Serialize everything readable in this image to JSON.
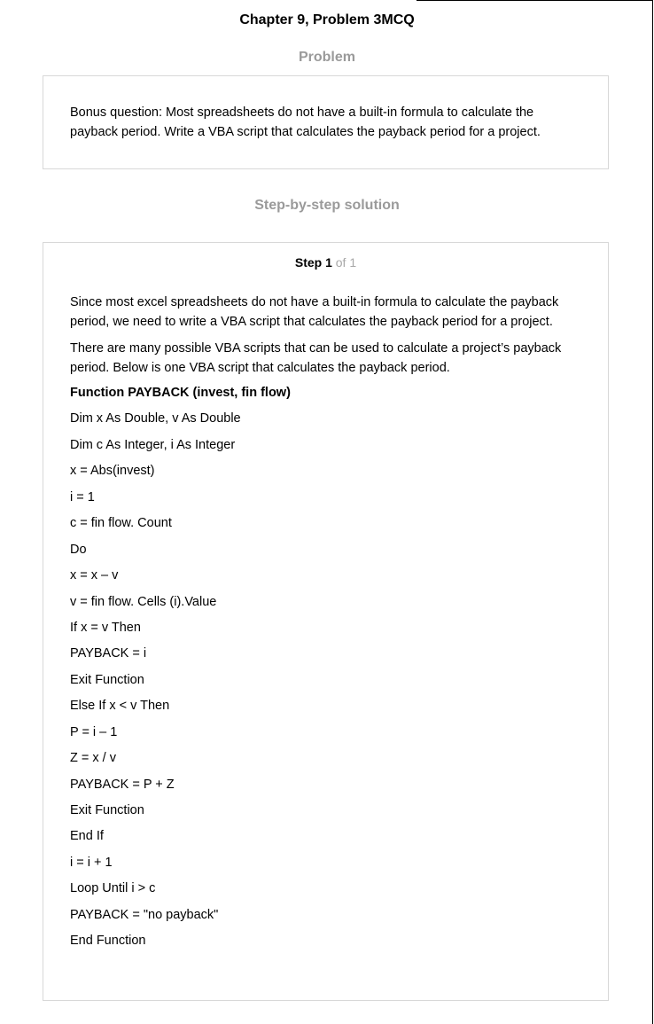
{
  "header": {
    "chapter_title": "Chapter 9, Problem 3MCQ",
    "problem_heading": "Problem",
    "solution_heading": "Step-by-step solution"
  },
  "problem": {
    "text": "Bonus question: Most spreadsheets do not have a built-in formula to calculate the payback period. Write a VBA script that calculates the payback period for a project."
  },
  "solution": {
    "step_label": "Step 1",
    "step_of": "of 1",
    "paragraphs": [
      "Since most excel spreadsheets do not have a built-in formula to calculate the payback period, we need to write a VBA script that calculates the payback period for a project.",
      "There are many possible VBA scripts that can be used to calculate a project’s payback period. Below is one VBA script that calculates the payback period."
    ],
    "code_lines": [
      "Function PAYBACK (invest, fin flow)",
      "Dim x As Double, v As Double",
      "Dim c As Integer, i As Integer",
      "x = Abs(invest)",
      "i = 1",
      "c = fin flow. Count",
      "Do",
      "x = x – v",
      "v = fin flow. Cells (i).Value",
      "If x = v Then",
      "PAYBACK = i",
      "Exit Function",
      "Else If x < v Then",
      "P = i – 1",
      "Z = x / v",
      "PAYBACK = P + Z",
      "Exit Function",
      "End If",
      "i = i + 1",
      "Loop Until i > c",
      "PAYBACK = \"no payback\"",
      "End Function"
    ]
  }
}
